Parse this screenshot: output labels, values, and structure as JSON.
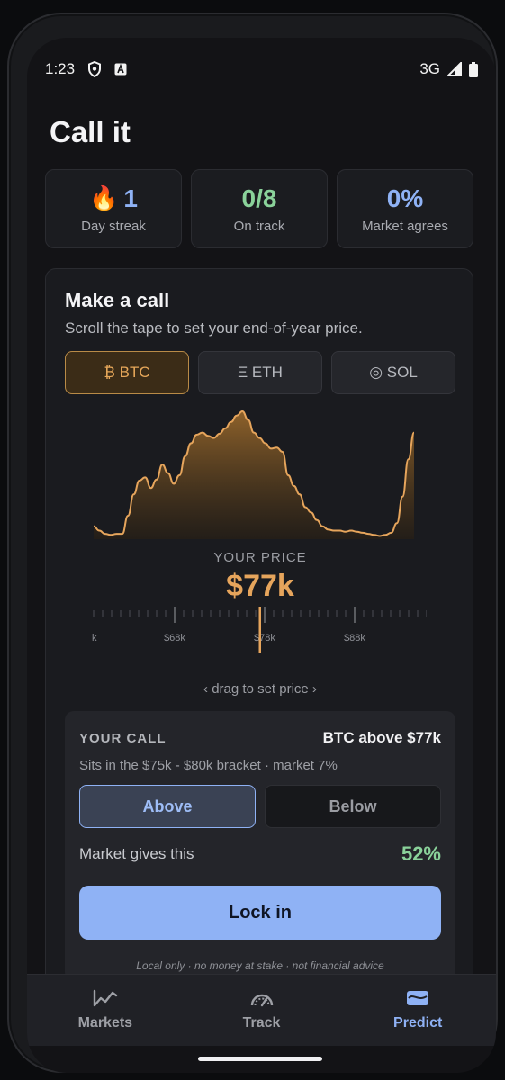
{
  "status": {
    "time": "1:23",
    "network": "3G"
  },
  "page": {
    "title": "Call it"
  },
  "stats": [
    {
      "emoji": "🔥",
      "value": "1",
      "label": "Day streak"
    },
    {
      "value": "0/8",
      "label": "On track"
    },
    {
      "value": "0%",
      "label": "Market agrees"
    }
  ],
  "card": {
    "title": "Make a call",
    "subtitle": "Scroll the tape to set your end-of-year price.",
    "coins": [
      {
        "label": "₿ BTC",
        "selected": true
      },
      {
        "label": "Ξ ETH",
        "selected": false
      },
      {
        "label": "◎ SOL",
        "selected": false
      }
    ],
    "price_label": "YOUR PRICE",
    "price_value": "$77k",
    "ruler_labels": [
      "k",
      "$68k",
      "$78k",
      "$88k"
    ],
    "drag_hint": "‹ drag to set price ›"
  },
  "chart_data": {
    "type": "area",
    "accent": "#e6a55c",
    "values": [
      12,
      8,
      5,
      4,
      5,
      5,
      22,
      42,
      55,
      58,
      48,
      56,
      70,
      62,
      52,
      60,
      78,
      90,
      98,
      100,
      97,
      95,
      99,
      104,
      110,
      116,
      120,
      112,
      100,
      95,
      90,
      85,
      86,
      82,
      60,
      50,
      42,
      30,
      25,
      18,
      12,
      9,
      8,
      8,
      7,
      8,
      7,
      6,
      5,
      4,
      3,
      4,
      6,
      15,
      40,
      75,
      100
    ]
  },
  "call": {
    "label": "YOUR CALL",
    "value": "BTC above $77k",
    "subtitle": "Sits in the $75k - $80k bracket · market 7%",
    "above_label": "Above",
    "below_label": "Below",
    "odds_label": "Market gives this",
    "odds_value": "52%",
    "lock_label": "Lock in",
    "disclaimer": "Local only · no money at stake · not financial advice"
  },
  "nav": {
    "items": [
      {
        "label": "Markets",
        "icon": "chart-line-icon"
      },
      {
        "label": "Track",
        "icon": "gauge-icon"
      },
      {
        "label": "Predict",
        "icon": "wave-icon"
      }
    ]
  },
  "colors": {
    "accent": "#8fb2f5",
    "orange": "#e6a55c",
    "green": "#8ad29a"
  }
}
